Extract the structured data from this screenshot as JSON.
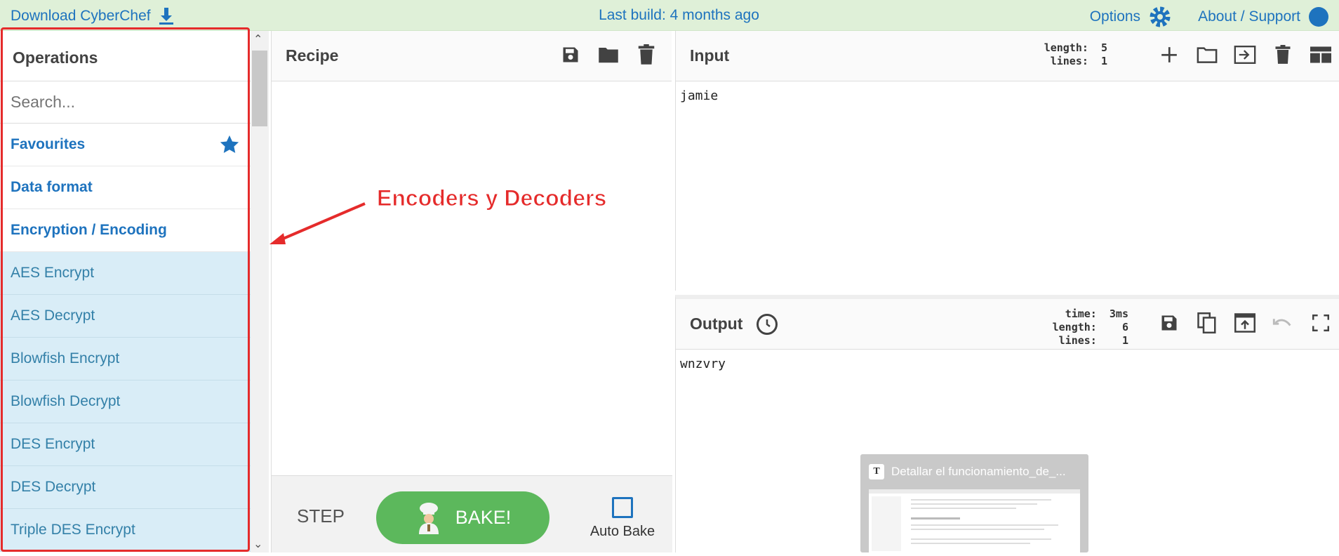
{
  "topbar": {
    "download_label": "Download CyberChef",
    "last_build": "Last build: 4 months ago",
    "options_label": "Options",
    "about_label": "About / Support"
  },
  "operations": {
    "title": "Operations",
    "search_placeholder": "Search...",
    "categories": [
      "Favourites",
      "Data format",
      "Encryption / Encoding"
    ],
    "items": [
      "AES Encrypt",
      "AES Decrypt",
      "Blowfish Encrypt",
      "Blowfish Decrypt",
      "DES Encrypt",
      "DES Decrypt",
      "Triple DES Encrypt"
    ]
  },
  "recipe": {
    "title": "Recipe",
    "step_label": "STEP",
    "bake_label": "BAKE!",
    "auto_bake_label": "Auto Bake"
  },
  "input": {
    "title": "Input",
    "value": "jamie",
    "length_label": "length:",
    "length": "5",
    "lines_label": "lines:",
    "lines": "1"
  },
  "output": {
    "title": "Output",
    "value": "wnzvry",
    "time_label": "time:",
    "time": "3ms",
    "length_label": "length:",
    "length": "6",
    "lines_label": "lines:",
    "lines": "1"
  },
  "annotation": {
    "text": "Encoders y Decoders"
  },
  "taskbar_thumb": {
    "title": "Detallar el funcionamiento_de_..."
  },
  "colors": {
    "accent": "#1e73be",
    "topbar_bg": "#dff0d8",
    "op_item_bg": "#d9edf7",
    "bake_green": "#5cb85c",
    "annotation_red": "#e52b2b"
  }
}
